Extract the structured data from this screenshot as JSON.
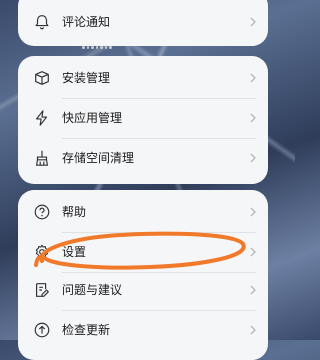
{
  "group1": {
    "items": [
      {
        "label": "评论通知",
        "icon": "bell-icon"
      }
    ]
  },
  "group2": {
    "items": [
      {
        "label": "安装管理",
        "icon": "box-icon"
      },
      {
        "label": "快应用管理",
        "icon": "lightning-icon"
      },
      {
        "label": "存储空间清理",
        "icon": "broom-icon"
      }
    ]
  },
  "group3": {
    "items": [
      {
        "label": "帮助",
        "icon": "help-icon"
      },
      {
        "label": "设置",
        "icon": "gear-icon"
      },
      {
        "label": "问题与建议",
        "icon": "feedback-icon"
      },
      {
        "label": "检查更新",
        "icon": "update-icon"
      }
    ]
  },
  "annotation": {
    "color": "#f07a2a",
    "target": "设置"
  }
}
